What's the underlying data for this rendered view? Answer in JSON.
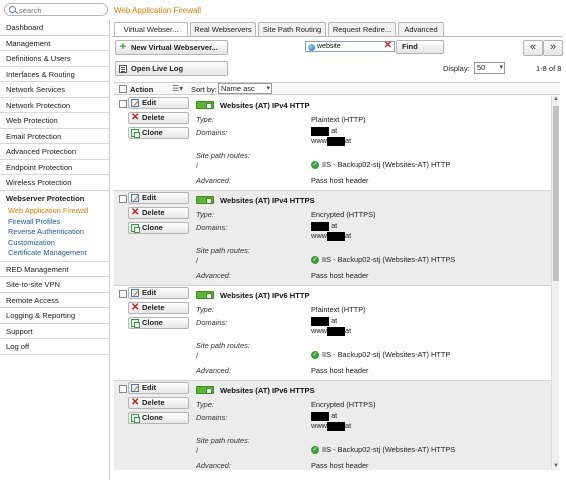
{
  "topbar": {
    "search_placeholder": "search",
    "page_title": "Web Application Firewall"
  },
  "sidebar": {
    "items_top": [
      {
        "label": "Dashboard"
      },
      {
        "label": "Management"
      },
      {
        "label": "Definitions & Users"
      },
      {
        "label": "Interfaces & Routing"
      },
      {
        "label": "Network Services"
      },
      {
        "label": "Network Protection"
      },
      {
        "label": "Web Protection"
      },
      {
        "label": "Email Protection"
      },
      {
        "label": "Advanced Protection"
      },
      {
        "label": "Endpoint Protection"
      },
      {
        "label": "Wireless Protection"
      }
    ],
    "active_section": "Webserver Protection",
    "subitems": [
      {
        "label": "Web Application Firewall",
        "current": true
      },
      {
        "label": "Firewall Profiles"
      },
      {
        "label": "Reverse Authentication"
      },
      {
        "label": "Customization"
      },
      {
        "label": "Certificate Management"
      }
    ],
    "items_bottom": [
      {
        "label": "RED Management"
      },
      {
        "label": "Site-to-site VPN"
      },
      {
        "label": "Remote Access"
      },
      {
        "label": "Logging & Reporting"
      },
      {
        "label": "Support"
      },
      {
        "label": "Log off"
      }
    ]
  },
  "tabs": [
    {
      "label": "Virtual Webser...",
      "selected": true
    },
    {
      "label": "Real Webservers"
    },
    {
      "label": "Site Path Routing"
    },
    {
      "label": "Request Redire..."
    },
    {
      "label": "Advanced"
    }
  ],
  "toolbar": {
    "new_button": "New Virtual Webserver...",
    "live_log_button": "Open Live Log",
    "filter_value": "website",
    "find_button": "Find",
    "prev_page": "«",
    "next_page": "»",
    "display_label": "Display:",
    "display_value": "50",
    "range": "1-8 of 8"
  },
  "list_header": {
    "action": "Action",
    "columns_icon": "☰▾",
    "sort_label": "Sort by:",
    "sort_value": "Name asc"
  },
  "labels": {
    "edit": "Edit",
    "delete": "Delete",
    "clone": "Clone",
    "type": "Type:",
    "domains": "Domains:",
    "site_path_routes": "Site path routes:",
    "advanced": "Advanced:"
  },
  "rows": [
    {
      "title": "Websites (AT) IPv4 HTTP",
      "type": "Plaintext (HTTP)",
      "domain1_suffix": "at",
      "domain2_prefix": "www",
      "domain2_suffix": "at",
      "route_path": "/",
      "route_target": "IIS - Backup02-stj (Websites-AT) HTTP",
      "advanced": "Pass host header",
      "enabled": true
    },
    {
      "title": "Websites (AT) IPv4 HTTPS",
      "type": "Encrypted (HTTPS)",
      "domain1_suffix": "at",
      "domain2_prefix": "www",
      "domain2_suffix": "at",
      "route_path": "/",
      "route_target": "IIS - Backup02-stj (Websites-AT) HTTPS",
      "advanced": "Pass host header",
      "enabled": true
    },
    {
      "title": "Websites (AT) IPv6 HTTP",
      "type": "Plaintext (HTTP)",
      "domain1_suffix": "at",
      "domain2_prefix": "www",
      "domain2_suffix": "at",
      "route_path": "/",
      "route_target": "IIS - Backup02-stj (Websites-AT) HTTP",
      "advanced": "Pass host header",
      "enabled": true
    },
    {
      "title": "Websites (AT) IPv6 HTTPS",
      "type": "Encrypted (HTTPS)",
      "domain1_suffix": "at",
      "domain2_prefix": "www",
      "domain2_suffix": "at",
      "route_path": "/",
      "route_target": "IIS - Backup02-stj (Websites-AT) HTTPS",
      "advanced": "Pass host header",
      "enabled": true
    }
  ]
}
